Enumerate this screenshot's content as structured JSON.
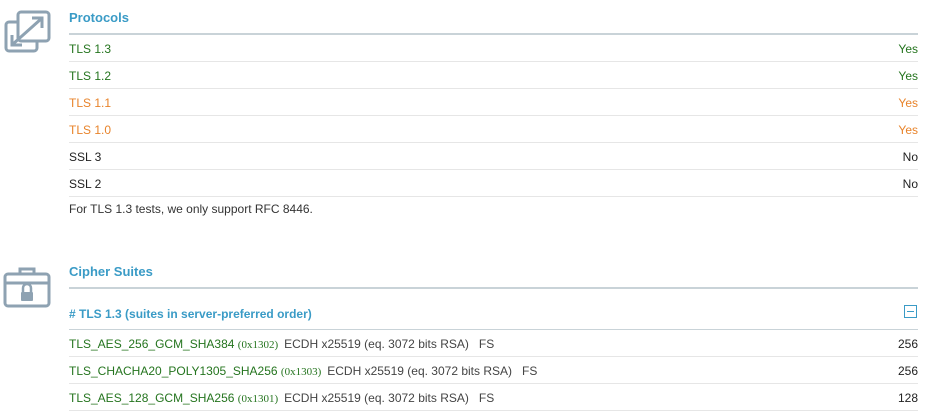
{
  "protocols": {
    "title": "Protocols",
    "icon": "resize-arrows-icon",
    "rows": [
      {
        "name": "TLS 1.3",
        "value": "Yes",
        "color": "#24741e"
      },
      {
        "name": "TLS 1.2",
        "value": "Yes",
        "color": "#24741e"
      },
      {
        "name": "TLS 1.1",
        "value": "Yes",
        "color": "#e8832a"
      },
      {
        "name": "TLS 1.0",
        "value": "Yes",
        "color": "#e8832a"
      },
      {
        "name": "SSL 3",
        "value": "No",
        "color": "#1f1f1f"
      },
      {
        "name": "SSL 2",
        "value": "No",
        "color": "#1f1f1f"
      }
    ],
    "note": "For TLS 1.3 tests, we only support RFC 8446."
  },
  "cipher_suites": {
    "title": "Cipher Suites",
    "icon": "padlock-briefcase-icon",
    "group": {
      "title": "# TLS 1.3 (suites in server-preferred order)",
      "collapse_icon": "minus-box-icon",
      "suites": [
        {
          "name": "TLS_AES_256_GCM_SHA384",
          "code": "(0x1302)",
          "details": "ECDH x25519 (eq. 3072 bits RSA)",
          "fs": "FS",
          "bits": "256"
        },
        {
          "name": "TLS_CHACHA20_POLY1305_SHA256",
          "code": "(0x1303)",
          "details": "ECDH x25519 (eq. 3072 bits RSA)",
          "fs": "FS",
          "bits": "256"
        },
        {
          "name": "TLS_AES_128_GCM_SHA256",
          "code": "(0x1301)",
          "details": "ECDH x25519 (eq. 3072 bits RSA)",
          "fs": "FS",
          "bits": "128"
        }
      ]
    }
  },
  "colors": {
    "accent": "#3a9bc6",
    "ok": "#24741e",
    "warn": "#e8832a",
    "icon": "#8ea2b2"
  }
}
